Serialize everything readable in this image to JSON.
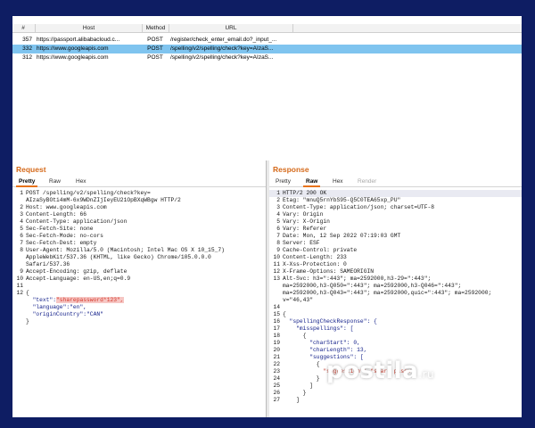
{
  "history": {
    "headers": [
      "#",
      "Host",
      "Method",
      "URL"
    ],
    "rows": [
      {
        "num": "357",
        "host": "https://passport.alibabacloud.c...",
        "method": "POST",
        "url": "/register/check_enter_email.do?_input_..."
      },
      {
        "num": "332",
        "host": "https://www.googleapis.com",
        "method": "POST",
        "url": "/spelling/v2/spelling/check?key=AIzaS..."
      },
      {
        "num": "312",
        "host": "https://www.googleapis.com",
        "method": "POST",
        "url": "/spelling/v2/spelling/check?key=AIzaS..."
      }
    ],
    "selected_color": "#7fc4ef"
  },
  "request": {
    "title": "Request",
    "tabs": [
      "Pretty",
      "Raw",
      "Hex"
    ],
    "lines": [
      {
        "n": "1",
        "t": "POST /spelling/v2/spelling/check?key="
      },
      {
        "n": "",
        "t": "AIzaSyBOti4mM-6x9WDnZIjIeyEU21OpBXqWBgw HTTP/2"
      },
      {
        "n": "2",
        "t": "Host: www.googleapis.com"
      },
      {
        "n": "3",
        "t": "Content-Length: 66"
      },
      {
        "n": "4",
        "t": "Content-Type: application/json"
      },
      {
        "n": "5",
        "t": "Sec-Fetch-Site: none"
      },
      {
        "n": "6",
        "t": "Sec-Fetch-Mode: no-cors"
      },
      {
        "n": "7",
        "t": "Sec-Fetch-Dest: empty"
      },
      {
        "n": "8",
        "t": "User-Agent: Mozilla/5.0 (Macintosh; Intel Mac OS X 10_15_7)"
      },
      {
        "n": "",
        "t": "AppleWebKit/537.36 (KHTML, like Gecko) Chrome/105.0.0.0"
      },
      {
        "n": "",
        "t": "Safari/537.36"
      },
      {
        "n": "9",
        "t": "Accept-Encoding: gzip, deflate"
      },
      {
        "n": "10",
        "t": "Accept-Language: en-US,en;q=0.9"
      },
      {
        "n": "11",
        "t": ""
      },
      {
        "n": "12",
        "t": "{"
      },
      {
        "n": "",
        "t": "\"text\":"
      },
      {
        "n": "",
        "t": "\"language\":\"en\","
      },
      {
        "n": "",
        "t": "\"originCountry\":\"CAN\""
      },
      {
        "n": "",
        "t": "}"
      }
    ],
    "secret_value": "\"sharepassword*123\","
  },
  "response": {
    "title": "Response",
    "tabs": [
      "Pretty",
      "Raw",
      "Hex",
      "Render"
    ],
    "lines": [
      {
        "n": "1",
        "t": "HTTP/2 200 OK"
      },
      {
        "n": "2",
        "t": "Etag: \"mnuQ5rnYbS95-Q5C0TEA65xp_PU\""
      },
      {
        "n": "3",
        "t": "Content-Type: application/json; charset=UTF-8"
      },
      {
        "n": "4",
        "t": "Vary: Origin"
      },
      {
        "n": "5",
        "t": "Vary: X-Origin"
      },
      {
        "n": "6",
        "t": "Vary: Referer"
      },
      {
        "n": "7",
        "t": "Date: Mon, 12 Sep 2022 07:19:03 GMT"
      },
      {
        "n": "8",
        "t": "Server: ESF"
      },
      {
        "n": "9",
        "t": "Cache-Control: private"
      },
      {
        "n": "10",
        "t": "Content-Length: 233"
      },
      {
        "n": "11",
        "t": "X-Xss-Protection: 0"
      },
      {
        "n": "12",
        "t": "X-Frame-Options: SAMEORIGIN"
      },
      {
        "n": "13",
        "t": "Alt-Svc: h3=\":443\"; ma=2592000,h3-29=\":443\";"
      },
      {
        "n": "",
        "t": "ma=2592000,h3-Q050=\":443\"; ma=2592000,h3-Q046=\":443\";"
      },
      {
        "n": "",
        "t": "ma=2592000,h3-Q043=\":443\"; ma=2592000,quic=\":443\"; ma=2592000;"
      },
      {
        "n": "",
        "t": "v=\"46,43\""
      },
      {
        "n": "14",
        "t": ""
      },
      {
        "n": "15",
        "t": "{"
      },
      {
        "n": "16",
        "t": "  \"spellingCheckResponse\": {"
      },
      {
        "n": "17",
        "t": "    \"misspellings\": ["
      },
      {
        "n": "18",
        "t": "      {"
      },
      {
        "n": "19",
        "t": "        \"charStart\": 0,"
      },
      {
        "n": "20",
        "t": "        \"charLength\": 13,"
      },
      {
        "n": "21",
        "t": "        \"suggestions\": ["
      },
      {
        "n": "22",
        "t": "          {"
      },
      {
        "n": "23",
        "t": "            \"suggestion\": \"share passw"
      },
      {
        "n": "24",
        "t": "          }"
      },
      {
        "n": "25",
        "t": "        ]"
      },
      {
        "n": "26",
        "t": "      }"
      },
      {
        "n": "27",
        "t": "    ]"
      }
    ]
  },
  "watermark": {
    "brand": "postila",
    "suffix": ".ru"
  },
  "colors": {
    "accent": "#e8731b",
    "title": "#d56a1b",
    "background": "#0e1d63",
    "secret": "#d4372a"
  }
}
